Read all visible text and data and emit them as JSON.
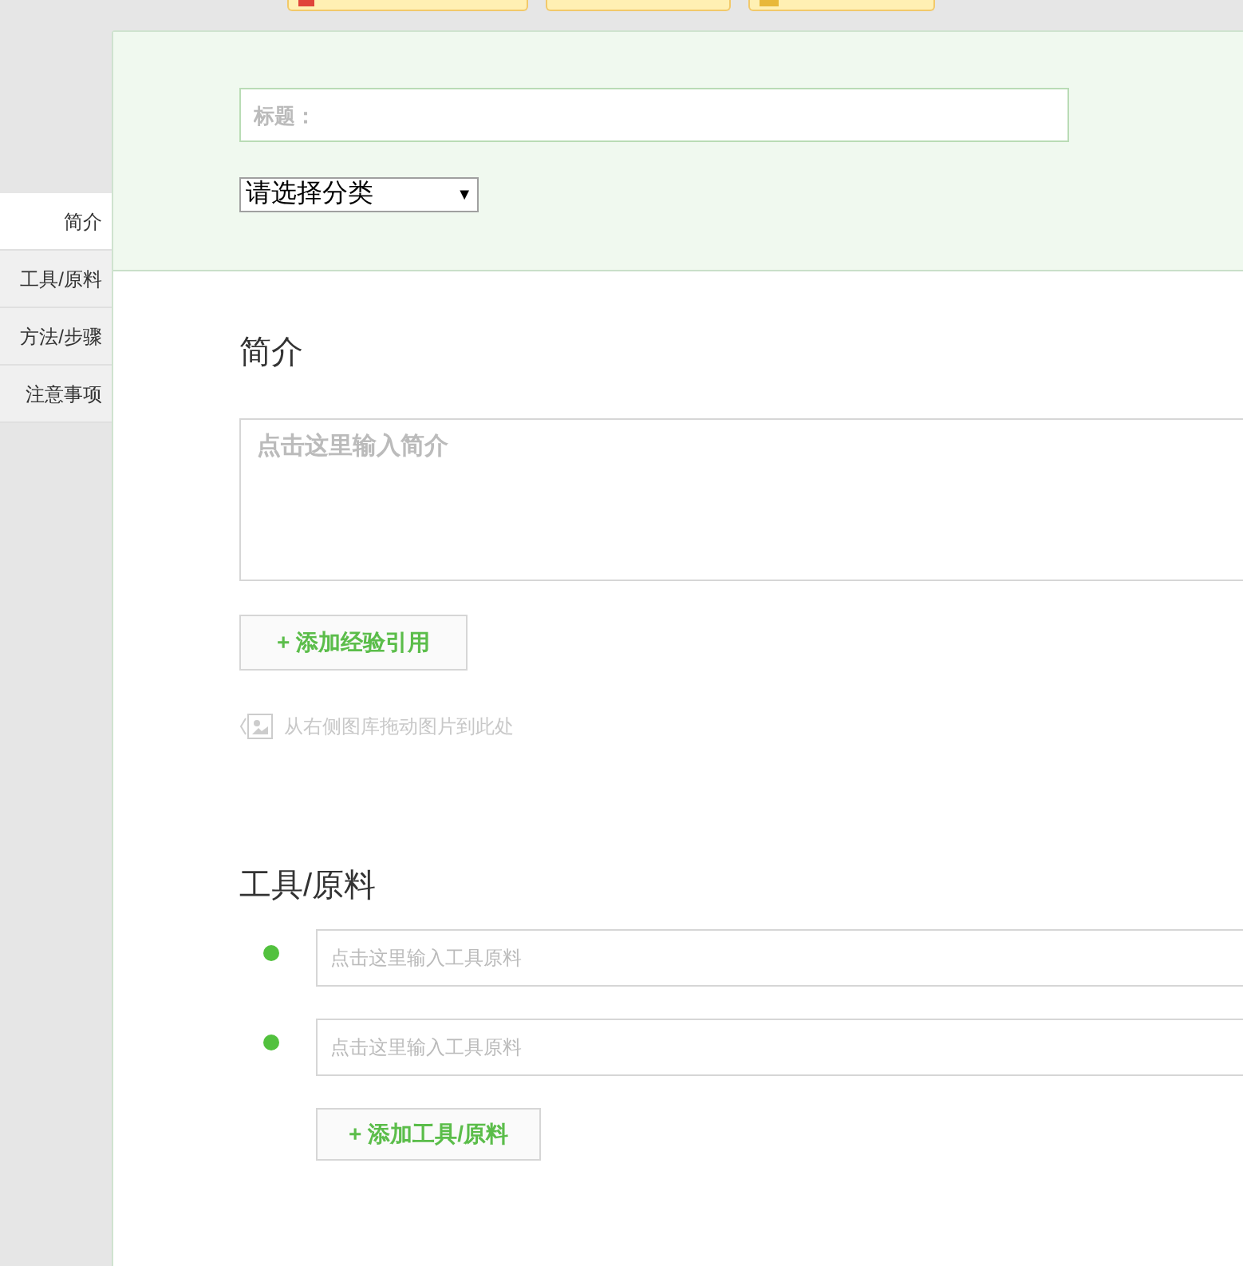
{
  "sidebar": {
    "items": [
      {
        "label": "简介",
        "selected": true
      },
      {
        "label": "工具/原料",
        "selected": false
      },
      {
        "label": "方法/步骤",
        "selected": false
      },
      {
        "label": "注意事项",
        "selected": false
      }
    ]
  },
  "header": {
    "title_field": {
      "placeholder": "标题："
    },
    "category_select": {
      "value": "请选择分类",
      "arrow": "▼"
    }
  },
  "intro": {
    "heading": "简介",
    "textarea": {
      "placeholder": "点击这里输入简介"
    },
    "add_button": "+ 添加经验引用",
    "image_hint": "从右侧图库拖动图片到此处"
  },
  "tools": {
    "heading": "工具/原料",
    "items": [
      {
        "placeholder": "点击这里输入工具原料"
      },
      {
        "placeholder": "点击这里输入工具原料"
      }
    ],
    "add_button": "+ 添加工具/原料"
  }
}
